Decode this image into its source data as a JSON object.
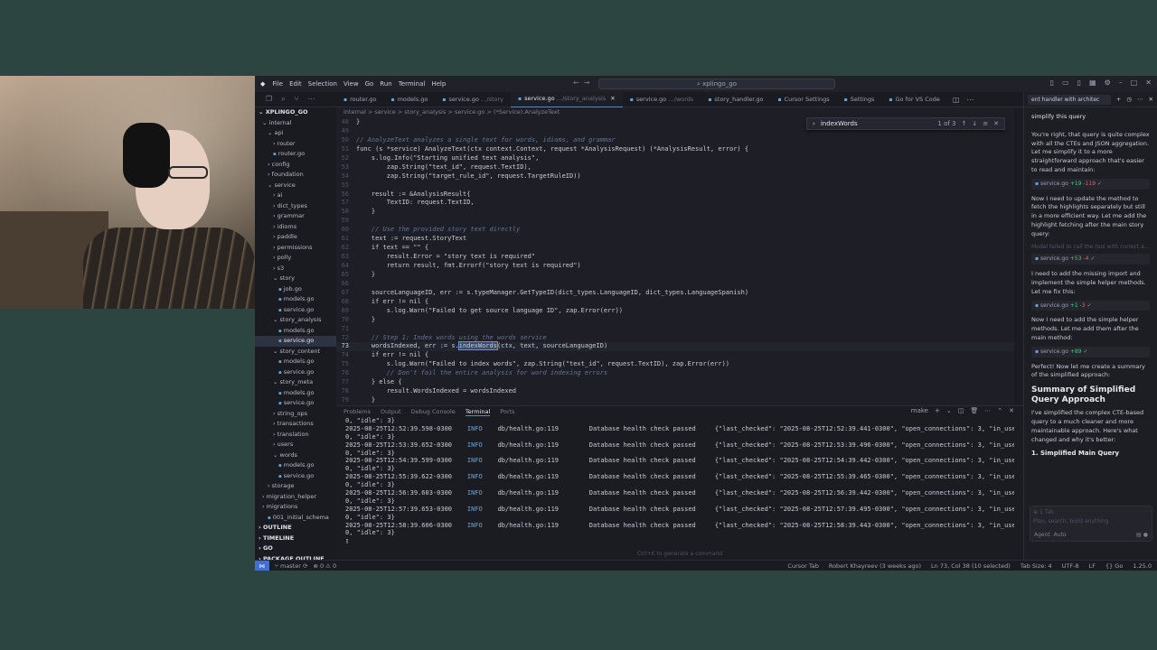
{
  "titlebar": {
    "menu": [
      "File",
      "Edit",
      "Selection",
      "View",
      "Go",
      "Run",
      "Terminal",
      "Help"
    ],
    "search": "xplingo_go"
  },
  "tabs": [
    {
      "label": "router.go",
      "desc": "",
      "active": false
    },
    {
      "label": "models.go",
      "desc": "",
      "active": false
    },
    {
      "label": "service.go",
      "desc": "…/story",
      "active": false
    },
    {
      "label": "service.go",
      "desc": "…/story_analysis",
      "active": true
    },
    {
      "label": "service.go",
      "desc": "…/words",
      "active": false
    },
    {
      "label": "story_handler.go",
      "desc": "",
      "active": false
    },
    {
      "label": "Cursor Settings",
      "desc": "",
      "active": false
    },
    {
      "label": "Settings",
      "desc": "",
      "active": false
    },
    {
      "label": "Go for VS Code",
      "desc": "",
      "active": false
    }
  ],
  "sidebar": {
    "root": "XPLINGO_GO",
    "tree": [
      {
        "label": "internal",
        "indent": 1,
        "type": "folder",
        "open": true
      },
      {
        "label": "api",
        "indent": 2,
        "type": "folder",
        "open": true
      },
      {
        "label": "router",
        "indent": 3,
        "type": "folder",
        "open": false
      },
      {
        "label": "router.go",
        "indent": 3,
        "type": "file"
      },
      {
        "label": "config",
        "indent": 2,
        "type": "folder",
        "open": false
      },
      {
        "label": "foundation",
        "indent": 2,
        "type": "folder",
        "open": false
      },
      {
        "label": "service",
        "indent": 2,
        "type": "folder",
        "open": true
      },
      {
        "label": "ai",
        "indent": 3,
        "type": "folder",
        "open": false
      },
      {
        "label": "dict_types",
        "indent": 3,
        "type": "folder",
        "open": false
      },
      {
        "label": "grammar",
        "indent": 3,
        "type": "folder",
        "open": false
      },
      {
        "label": "idioms",
        "indent": 3,
        "type": "folder",
        "open": false
      },
      {
        "label": "paddle",
        "indent": 3,
        "type": "folder",
        "open": false
      },
      {
        "label": "permissions",
        "indent": 3,
        "type": "folder",
        "open": false
      },
      {
        "label": "polly",
        "indent": 3,
        "type": "folder",
        "open": false
      },
      {
        "label": "s3",
        "indent": 3,
        "type": "folder",
        "open": false
      },
      {
        "label": "story",
        "indent": 3,
        "type": "folder",
        "open": true
      },
      {
        "label": "job.go",
        "indent": 4,
        "type": "file"
      },
      {
        "label": "models.go",
        "indent": 4,
        "type": "file"
      },
      {
        "label": "service.go",
        "indent": 4,
        "type": "file"
      },
      {
        "label": "story_analysis",
        "indent": 3,
        "type": "folder",
        "open": true
      },
      {
        "label": "models.go",
        "indent": 4,
        "type": "file"
      },
      {
        "label": "service.go",
        "indent": 4,
        "type": "file",
        "selected": true
      },
      {
        "label": "story_content",
        "indent": 3,
        "type": "folder",
        "open": true
      },
      {
        "label": "models.go",
        "indent": 4,
        "type": "file"
      },
      {
        "label": "service.go",
        "indent": 4,
        "type": "file"
      },
      {
        "label": "story_meta",
        "indent": 3,
        "type": "folder",
        "open": true
      },
      {
        "label": "models.go",
        "indent": 4,
        "type": "file"
      },
      {
        "label": "service.go",
        "indent": 4,
        "type": "file"
      },
      {
        "label": "string_ops",
        "indent": 3,
        "type": "folder",
        "open": false
      },
      {
        "label": "transactions",
        "indent": 3,
        "type": "folder",
        "open": false
      },
      {
        "label": "translation",
        "indent": 3,
        "type": "folder",
        "open": false
      },
      {
        "label": "users",
        "indent": 3,
        "type": "folder",
        "open": false
      },
      {
        "label": "words",
        "indent": 3,
        "type": "folder",
        "open": true
      },
      {
        "label": "models.go",
        "indent": 4,
        "type": "file"
      },
      {
        "label": "service.go",
        "indent": 4,
        "type": "file"
      },
      {
        "label": "storage",
        "indent": 2,
        "type": "folder",
        "open": false
      },
      {
        "label": "migration_helper",
        "indent": 1,
        "type": "folder",
        "open": false
      },
      {
        "label": "migrations",
        "indent": 1,
        "type": "folder",
        "open": false
      },
      {
        "label": "001_initial_schema",
        "indent": 2,
        "type": "file"
      }
    ],
    "sections": [
      "OUTLINE",
      "TIMELINE",
      "GO",
      "PACKAGE OUTLINE"
    ]
  },
  "editor": {
    "breadcrumb": "internal > service > story_analysis > service.go > (*Service).AnalyzeText",
    "find": {
      "query": "indexWords",
      "count": "1 of 3"
    },
    "lines": [
      {
        "n": "48",
        "t": "}"
      },
      {
        "n": "49",
        "t": ""
      },
      {
        "n": "50",
        "t": "// AnalyzeText analyzes a single text for words, idioms, and grammar",
        "c": true
      },
      {
        "n": "51",
        "t": "func (s *service) AnalyzeText(ctx context.Context, request *AnalysisRequest) (*AnalysisResult, error) {"
      },
      {
        "n": "52",
        "t": "    s.log.Info(\"Starting unified text analysis\","
      },
      {
        "n": "53",
        "t": "        zap.String(\"text_id\", request.TextID),"
      },
      {
        "n": "54",
        "t": "        zap.String(\"target_rule_id\", request.TargetRuleID))"
      },
      {
        "n": "55",
        "t": ""
      },
      {
        "n": "56",
        "t": "    result := &AnalysisResult{"
      },
      {
        "n": "57",
        "t": "        TextID: request.TextID,"
      },
      {
        "n": "58",
        "t": "    }"
      },
      {
        "n": "59",
        "t": ""
      },
      {
        "n": "60",
        "t": "    // Use the provided story text directly",
        "c": true
      },
      {
        "n": "61",
        "t": "    text := request.StoryText"
      },
      {
        "n": "62",
        "t": "    if text == \"\" {"
      },
      {
        "n": "63",
        "t": "        result.Error = \"story text is required\""
      },
      {
        "n": "64",
        "t": "        return result, fmt.Errorf(\"story text is required\")"
      },
      {
        "n": "65",
        "t": "    }"
      },
      {
        "n": "66",
        "t": ""
      },
      {
        "n": "67",
        "t": "    sourceLanguageID, err := s.typeManager.GetTypeID(dict_types.LanguageID, dict_types.LanguageSpanish)"
      },
      {
        "n": "68",
        "t": "    if err != nil {"
      },
      {
        "n": "69",
        "t": "        s.log.Warn(\"Failed to get source language ID\", zap.Error(err))"
      },
      {
        "n": "70",
        "t": "    }"
      },
      {
        "n": "71",
        "t": ""
      },
      {
        "n": "72",
        "t": "    // Step 1: Index words using the words service",
        "c": true
      },
      {
        "n": "73",
        "t": "    wordsIndexed, err := s.",
        "hl": "indexWords",
        "rest": "(ctx, text, sourceLanguageID)",
        "cur": true
      },
      {
        "n": "74",
        "t": "    if err != nil {"
      },
      {
        "n": "75",
        "t": "        s.log.Warn(\"Failed to index words\", zap.String(\"text_id\", request.TextID), zap.Error(err))"
      },
      {
        "n": "76",
        "t": "        // Don't fail the entire analysis for word indexing errors",
        "c": true
      },
      {
        "n": "77",
        "t": "    } else {"
      },
      {
        "n": "78",
        "t": "        result.WordsIndexed = wordsIndexed"
      },
      {
        "n": "79",
        "t": "    }"
      }
    ]
  },
  "panel": {
    "tabs": [
      "Problems",
      "Output",
      "Debug Console",
      "Terminal",
      "Ports"
    ],
    "active_tab": "Terminal",
    "shell": "make",
    "logs": [
      {
        "pre": "0, \"idle\": 3}"
      },
      {
        "ts": "2025-08-25T12:52:39.598-0300",
        "lvl": "INFO",
        "src": "db/health.go:119",
        "msg": "Database health check passed",
        "json": "{\"last_checked\": \"2025-08-25T12:52:39.441-0300\", \"open_connections\": 3, \"in_use\":"
      },
      {
        "pre": "0, \"idle\": 3}"
      },
      {
        "ts": "2025-08-25T12:53:39.652-0300",
        "lvl": "INFO",
        "src": "db/health.go:119",
        "msg": "Database health check passed",
        "json": "{\"last_checked\": \"2025-08-25T12:53:39.496-0300\", \"open_connections\": 3, \"in_use\":"
      },
      {
        "pre": "0, \"idle\": 3}"
      },
      {
        "ts": "2025-08-25T12:54:39.599-0300",
        "lvl": "INFO",
        "src": "db/health.go:119",
        "msg": "Database health check passed",
        "json": "{\"last_checked\": \"2025-08-25T12:54:39.442-0300\", \"open_connections\": 3, \"in_use\":"
      },
      {
        "pre": "0, \"idle\": 3}"
      },
      {
        "ts": "2025-08-25T12:55:39.622-0300",
        "lvl": "INFO",
        "src": "db/health.go:119",
        "msg": "Database health check passed",
        "json": "{\"last_checked\": \"2025-08-25T12:55:39.465-0300\", \"open_connections\": 3, \"in_use\":"
      },
      {
        "pre": "0, \"idle\": 3}"
      },
      {
        "ts": "2025-08-25T12:56:39.603-0300",
        "lvl": "INFO",
        "src": "db/health.go:119",
        "msg": "Database health check passed",
        "json": "{\"last_checked\": \"2025-08-25T12:56:39.442-0300\", \"open_connections\": 3, \"in_use\":"
      },
      {
        "pre": "0, \"idle\": 3}"
      },
      {
        "ts": "2025-08-25T12:57:39.653-0300",
        "lvl": "INFO",
        "src": "db/health.go:119",
        "msg": "Database health check passed",
        "json": "{\"last_checked\": \"2025-08-25T12:57:39.495-0300\", \"open_connections\": 3, \"in_use\":"
      },
      {
        "pre": "0, \"idle\": 3}"
      },
      {
        "ts": "2025-08-25T12:58:39.606-0300",
        "lvl": "INFO",
        "src": "db/health.go:119",
        "msg": "Database health check passed",
        "json": "{\"last_checked\": \"2025-08-25T12:58:39.443-0300\", \"open_connections\": 3, \"in_use\":"
      },
      {
        "pre": "0, \"idle\": 3}"
      }
    ],
    "hint": "Ctrl+K to generate a command"
  },
  "chat": {
    "title": "ent handler with architec",
    "user_msg": "simplify this query",
    "p1": "You're right, that query is quite complex with all the CTEs and JSON aggregation. Let me simplify it to a more straightforward approach that's easier to read and maintain:",
    "chip1": {
      "file": "service.go",
      "add": "+19",
      "del": "-119"
    },
    "p2": "Now I need to update the method to fetch the highlights separately but still in a more efficient way. Let me add the highlight fetching after the main story query:",
    "muted1": "Model failed to call the tool with correct a...",
    "chip2": {
      "file": "service.go",
      "add": "+53",
      "del": "-4"
    },
    "p3": "I need to add the missing import and implement the simple helper methods. Let me fix this:",
    "chip3": {
      "file": "service.go",
      "add": "+1",
      "del": "-3"
    },
    "p4": "Now I need to add the simple helper methods. Let me add them after the main method:",
    "chip4": {
      "file": "service.go",
      "add": "+89",
      "del": ""
    },
    "p5": "Perfect! Now let me create a summary of the simplified approach:",
    "h2": "Summary of Simplified Query Approach",
    "p6": "I've simplified the complex CTE-based query to a much cleaner and more maintainable approach. Here's what changed and why it's better:",
    "h3": "1. Simplified Main Query",
    "input_tab": "1 Tab",
    "input_placeholder": "Plan, search, build anything",
    "mode": "Agent",
    "model": "Auto"
  },
  "status": {
    "branch": "master",
    "problems": "⊗ 0 ⚠ 0",
    "right": [
      "Cursor Tab",
      "Robert Khayreev (3 weeks ago)",
      "Ln 73, Col 38 (10 selected)",
      "Tab Size: 4",
      "UTF-8",
      "LF",
      "{} Go",
      "1.25.0"
    ]
  },
  "colors": {
    "accent": "#3f6fd8",
    "background": "#2c4540"
  }
}
